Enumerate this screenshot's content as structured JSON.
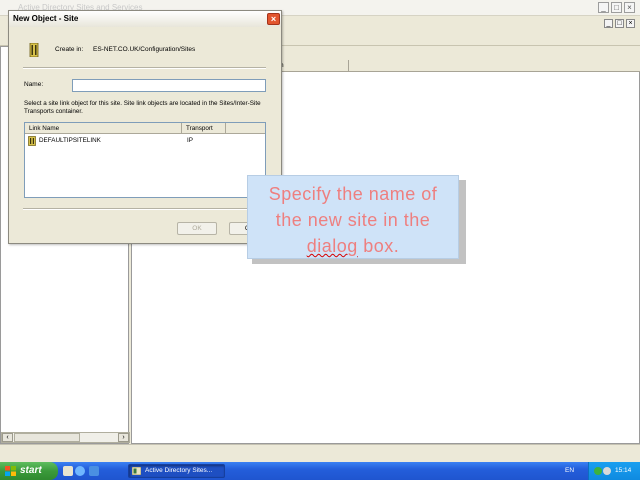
{
  "background_window": {
    "title": "Active Directory Sites and Services",
    "controls": {
      "minimize": "_",
      "maximize": "□",
      "close": "×"
    },
    "inner_controls": {
      "minimize": "_",
      "maximize": "□",
      "close": "×"
    },
    "list_columns": [
      "",
      "ion"
    ],
    "scroll_left": "‹",
    "scroll_right": "›"
  },
  "dialog": {
    "title": "New Object - Site",
    "close": "×",
    "create_in_label": "Create in:",
    "create_in_value": "ES-NET.CO.UK/Configuration/Sites",
    "name_label": "Name:",
    "name_value": "",
    "info_text": "Select a site link object for this site. Site link objects are located in the Sites/Inter-Site Transports container.",
    "columns": {
      "link_name": "Link Name",
      "transport": "Transport"
    },
    "rows": [
      {
        "name": "DEFAULTIPSITELINK",
        "transport": "IP"
      }
    ],
    "ok_label": "OK",
    "cancel_label": "Ca"
  },
  "callout": {
    "line1": "Specify the name of",
    "line2": "the new site in the",
    "line3_word": "dialog",
    "line3_rest": " box.",
    "text_color": "#ee7f7f",
    "bg_color": "#cfe3f8"
  },
  "taskbar": {
    "start_label": "start",
    "task_label": "Active Directory Sites...",
    "language": "EN",
    "clock": "15:14"
  },
  "colors": {
    "taskbar_blue": "#245edb",
    "start_green": "#3b9a3b",
    "close_red": "#e2552e"
  },
  "icons": [
    "site-icon",
    "site-link-icon",
    "windows-flag-icon",
    "ie-icon",
    "desktop-icon",
    "mmc-icon",
    "network-icon"
  ]
}
